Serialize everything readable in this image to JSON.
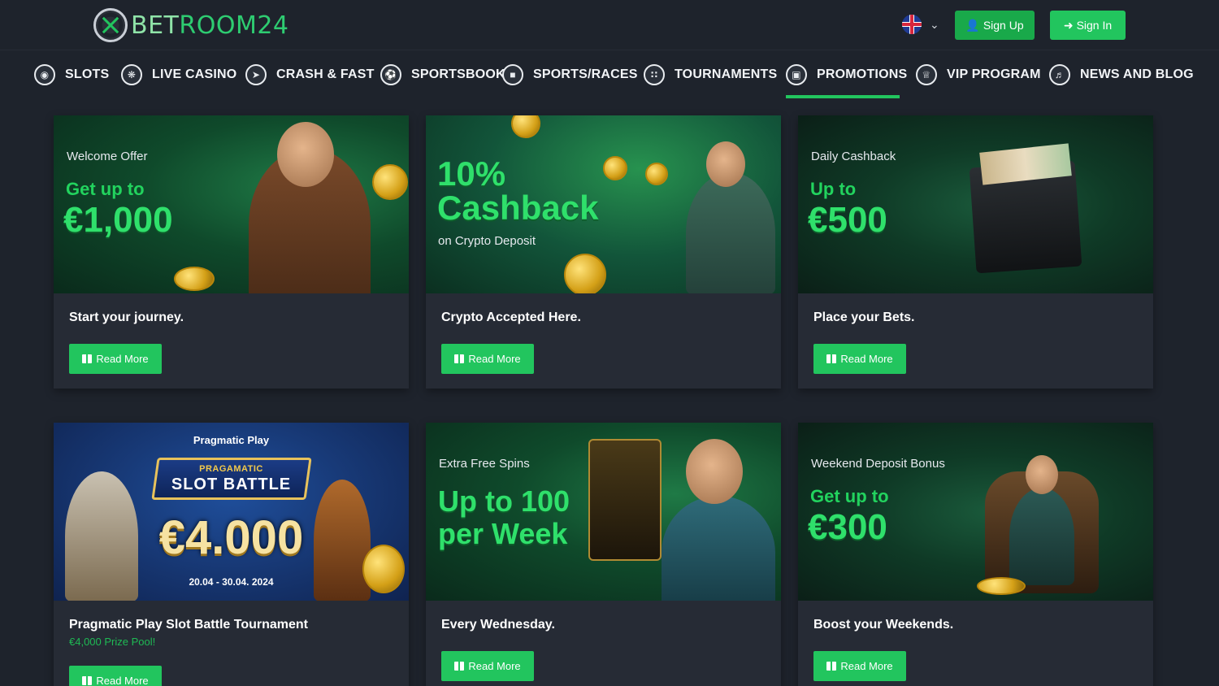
{
  "header": {
    "logo_part1": "BET",
    "logo_part2": "ROOM24",
    "language_icon": "uk-flag-icon",
    "signup_label": "Sign Up",
    "signin_label": "Sign In"
  },
  "nav": {
    "active_index": 6,
    "items": [
      {
        "label": "SLOTS",
        "icon": "slots-icon"
      },
      {
        "label": "LIVE CASINO",
        "icon": "live-casino-icon"
      },
      {
        "label": "CRASH & FAST",
        "icon": "rocket-icon"
      },
      {
        "label": "SPORTSBOOK",
        "icon": "soccer-ball-icon"
      },
      {
        "label": "SPORTS/RACES",
        "icon": "vr-icon"
      },
      {
        "label": "TOURNAMENTS",
        "icon": "dice-icon"
      },
      {
        "label": "PROMOTIONS",
        "icon": "gift-icon"
      },
      {
        "label": "VIP PROGRAM",
        "icon": "crown-icon"
      },
      {
        "label": "NEWS AND BLOG",
        "icon": "megaphone-icon"
      }
    ]
  },
  "promotions": [
    {
      "banner": {
        "eyebrow": "Welcome Offer",
        "line1": "Get up to",
        "amount": "€1,000"
      },
      "title": "Start your journey.",
      "button": "Read More"
    },
    {
      "banner": {
        "headline1": "10%",
        "headline2": "Cashback",
        "subline": "on Crypto Deposit"
      },
      "title": "Crypto Accepted Here.",
      "button": "Read More"
    },
    {
      "banner": {
        "eyebrow": "Daily Cashback",
        "line1": "Up to",
        "amount": "€500"
      },
      "title": "Place your Bets.",
      "button": "Read More"
    },
    {
      "banner": {
        "top": "Pragmatic Play",
        "sub": "PRAGAMATIC",
        "title": "SLOT BATTLE",
        "amount": "€4.000",
        "dates": "20.04 - 30.04. 2024"
      },
      "title": "Pragmatic Play Slot Battle Tournament",
      "subtitle": "€4,000 Prize Pool!",
      "button": "Read More"
    },
    {
      "banner": {
        "eyebrow": "Extra Free Spins",
        "headline1": "Up to 100",
        "headline2": "per Week"
      },
      "title": "Every Wednesday.",
      "button": "Read More"
    },
    {
      "banner": {
        "eyebrow": "Weekend Deposit Bonus",
        "line1": "Get up to",
        "amount": "€300"
      },
      "title": "Boost your Weekends.",
      "button": "Read More"
    }
  ],
  "colors": {
    "background": "#1e232c",
    "card": "#262b35",
    "accent": "#22c55e"
  }
}
